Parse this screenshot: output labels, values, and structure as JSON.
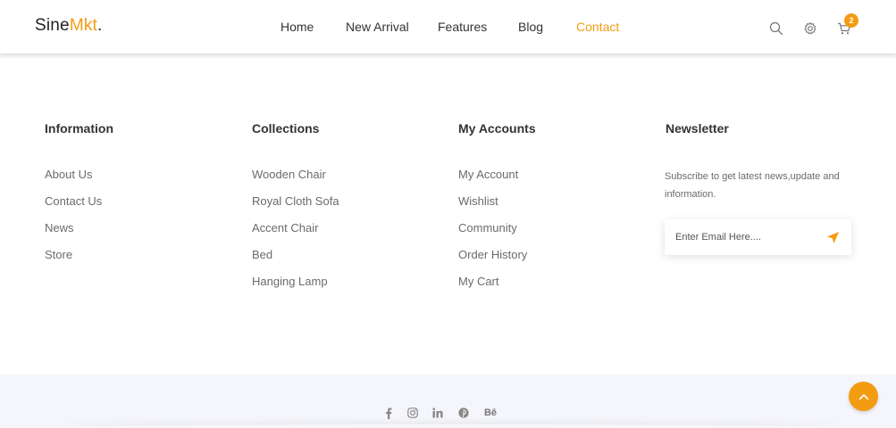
{
  "header": {
    "logo_main": "Sine",
    "logo_accent": "Mkt",
    "logo_dot": ".",
    "nav": {
      "home": "Home",
      "new_arrival": "New Arrival",
      "features": "Features",
      "blog": "Blog",
      "contact": "Contact"
    },
    "cart_count": "2"
  },
  "footer": {
    "information": {
      "title": "Information",
      "items": [
        "About Us",
        "Contact Us",
        "News",
        "Store"
      ]
    },
    "collections": {
      "title": "Collections",
      "items": [
        "Wooden Chair",
        "Royal Cloth Sofa",
        "Accent Chair",
        "Bed",
        "Hanging Lamp"
      ]
    },
    "accounts": {
      "title": "My Accounts",
      "items": [
        "My Account",
        "Wishlist",
        "Community",
        "Order History",
        "My Cart"
      ]
    },
    "newsletter": {
      "title": "Newsletter",
      "text": "Subscribe to get latest news,update and information.",
      "placeholder": "Enter Email Here...."
    },
    "social": {
      "behance_label": "Bē"
    }
  },
  "colors": {
    "accent": "#f39c12",
    "footer_bg": "#f5f6fb"
  },
  "icons": [
    "search-icon",
    "gear-icon",
    "cart-icon",
    "send-icon",
    "facebook-icon",
    "instagram-icon",
    "linkedin-icon",
    "pinterest-icon",
    "behance-icon",
    "chevron-up-icon"
  ]
}
